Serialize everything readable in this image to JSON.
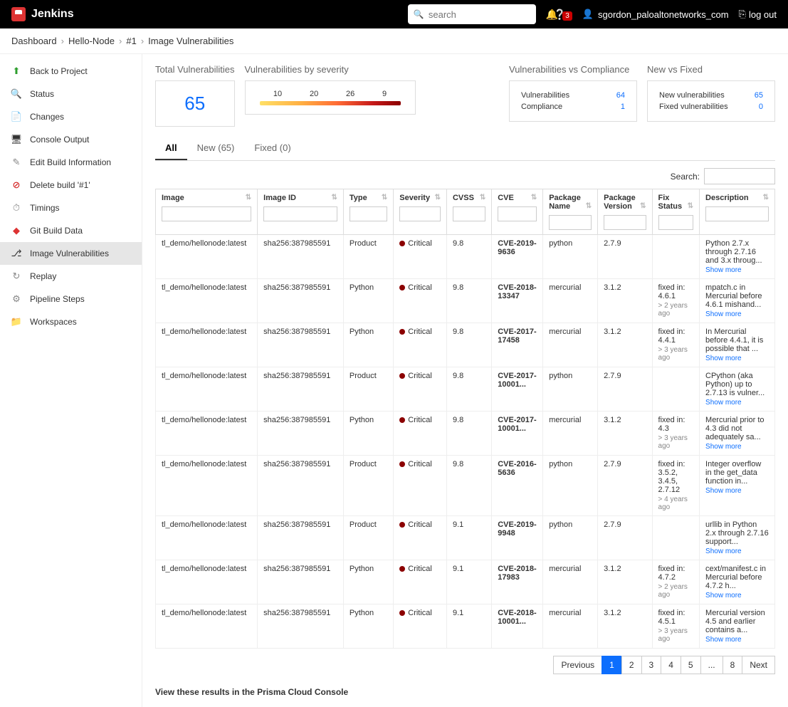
{
  "header": {
    "brand": "Jenkins",
    "search_placeholder": "search",
    "notif_count": "3",
    "username": "sgordon_paloaltonetworks_com",
    "logout": "log out"
  },
  "breadcrumb": [
    "Dashboard",
    "Hello-Node",
    "#1",
    "Image Vulnerabilities"
  ],
  "sidebar": {
    "items": [
      {
        "label": "Back to Project",
        "icon": "⬆",
        "color": "#2e9e2e"
      },
      {
        "label": "Status",
        "icon": "🔍",
        "color": "#888"
      },
      {
        "label": "Changes",
        "icon": "📄",
        "color": "#888"
      },
      {
        "label": "Console Output",
        "icon": "🖥",
        "color": "#333"
      },
      {
        "label": "Edit Build Information",
        "icon": "✎",
        "color": "#888"
      },
      {
        "label": "Delete build '#1'",
        "icon": "⊘",
        "color": "#c00"
      },
      {
        "label": "Timings",
        "icon": "⏱",
        "color": "#888"
      },
      {
        "label": "Git Build Data",
        "icon": "◆",
        "color": "#d33"
      },
      {
        "label": "Image Vulnerabilities",
        "icon": "⎇",
        "color": "#333",
        "active": true
      },
      {
        "label": "Replay",
        "icon": "↻",
        "color": "#888"
      },
      {
        "label": "Pipeline Steps",
        "icon": "⚙",
        "color": "#888"
      },
      {
        "label": "Workspaces",
        "icon": "📁",
        "color": "#3b7dd8"
      }
    ]
  },
  "stats": {
    "total_title": "Total Vulnerabilities",
    "total_value": "65",
    "sev_title": "Vulnerabilities by severity",
    "sev_values": [
      "10",
      "20",
      "26",
      "9"
    ],
    "vc_title": "Vulnerabilities vs Compliance",
    "vc_rows": [
      {
        "k": "Vulnerabilities",
        "v": "64"
      },
      {
        "k": "Compliance",
        "v": "1"
      }
    ],
    "nf_title": "New vs Fixed",
    "nf_rows": [
      {
        "k": "New vulnerabilities",
        "v": "65"
      },
      {
        "k": "Fixed vulnerabilities",
        "v": "0"
      }
    ]
  },
  "tabs": [
    {
      "label": "All",
      "active": true
    },
    {
      "label": "New (65)"
    },
    {
      "label": "Fixed (0)"
    }
  ],
  "search_label": "Search:",
  "columns": [
    "Image",
    "Image ID",
    "Type",
    "Severity",
    "CVSS",
    "CVE",
    "Package Name",
    "Package Version",
    "Fix Status",
    "Description"
  ],
  "rows": [
    {
      "image": "tl_demo/hellonode:latest",
      "image_id": "sha256:387985591",
      "type": "Product",
      "severity": "Critical",
      "cvss": "9.8",
      "cve": "CVE-2019-9636",
      "pkg": "python",
      "ver": "2.7.9",
      "fix": "",
      "fixsub": "",
      "desc": "Python 2.7.x through 2.7.16 and 3.x throug...",
      "show": true
    },
    {
      "image": "tl_demo/hellonode:latest",
      "image_id": "sha256:387985591",
      "type": "Python",
      "severity": "Critical",
      "cvss": "9.8",
      "cve": "CVE-2018-13347",
      "pkg": "mercurial",
      "ver": "3.1.2",
      "fix": "fixed in: 4.6.1",
      "fixsub": "> 2 years ago",
      "desc": "mpatch.c in Mercurial before 4.6.1 mishand...",
      "show": true
    },
    {
      "image": "tl_demo/hellonode:latest",
      "image_id": "sha256:387985591",
      "type": "Python",
      "severity": "Critical",
      "cvss": "9.8",
      "cve": "CVE-2017-17458",
      "pkg": "mercurial",
      "ver": "3.1.2",
      "fix": "fixed in: 4.4.1",
      "fixsub": "> 3 years ago",
      "desc": "In Mercurial before 4.4.1, it is possible that ...",
      "show": true
    },
    {
      "image": "tl_demo/hellonode:latest",
      "image_id": "sha256:387985591",
      "type": "Product",
      "severity": "Critical",
      "cvss": "9.8",
      "cve": "CVE-2017-10001...",
      "pkg": "python",
      "ver": "2.7.9",
      "fix": "",
      "fixsub": "",
      "desc": "CPython (aka Python) up to 2.7.13 is vulner...",
      "show": true
    },
    {
      "image": "tl_demo/hellonode:latest",
      "image_id": "sha256:387985591",
      "type": "Python",
      "severity": "Critical",
      "cvss": "9.8",
      "cve": "CVE-2017-10001...",
      "pkg": "mercurial",
      "ver": "3.1.2",
      "fix": "fixed in: 4.3",
      "fixsub": "> 3 years ago",
      "desc": "Mercurial prior to 4.3 did not adequately sa...",
      "show": true
    },
    {
      "image": "tl_demo/hellonode:latest",
      "image_id": "sha256:387985591",
      "type": "Product",
      "severity": "Critical",
      "cvss": "9.8",
      "cve": "CVE-2016-5636",
      "pkg": "python",
      "ver": "2.7.9",
      "fix": "fixed in: 3.5.2, 3.4.5, 2.7.12",
      "fixsub": "> 4 years ago",
      "desc": "Integer overflow in the get_data function in...",
      "show": true
    },
    {
      "image": "tl_demo/hellonode:latest",
      "image_id": "sha256:387985591",
      "type": "Product",
      "severity": "Critical",
      "cvss": "9.1",
      "cve": "CVE-2019-9948",
      "pkg": "python",
      "ver": "2.7.9",
      "fix": "",
      "fixsub": "",
      "desc": "urllib in Python 2.x through 2.7.16 support...",
      "show": true
    },
    {
      "image": "tl_demo/hellonode:latest",
      "image_id": "sha256:387985591",
      "type": "Python",
      "severity": "Critical",
      "cvss": "9.1",
      "cve": "CVE-2018-17983",
      "pkg": "mercurial",
      "ver": "3.1.2",
      "fix": "fixed in: 4.7.2",
      "fixsub": "> 2 years ago",
      "desc": "cext/manifest.c in Mercurial before 4.7.2 h...",
      "show": true
    },
    {
      "image": "tl_demo/hellonode:latest",
      "image_id": "sha256:387985591",
      "type": "Python",
      "severity": "Critical",
      "cvss": "9.1",
      "cve": "CVE-2018-10001...",
      "pkg": "mercurial",
      "ver": "3.1.2",
      "fix": "fixed in: 4.5.1",
      "fixsub": "> 3 years ago",
      "desc": "Mercurial version 4.5 and earlier contains a...",
      "show": true
    }
  ],
  "show_more": "Show more",
  "pagination": {
    "prev": "Previous",
    "pages": [
      "1",
      "2",
      "3",
      "4",
      "5",
      "...",
      "8"
    ],
    "next": "Next"
  },
  "footer": "View these results in the Prisma Cloud Console"
}
